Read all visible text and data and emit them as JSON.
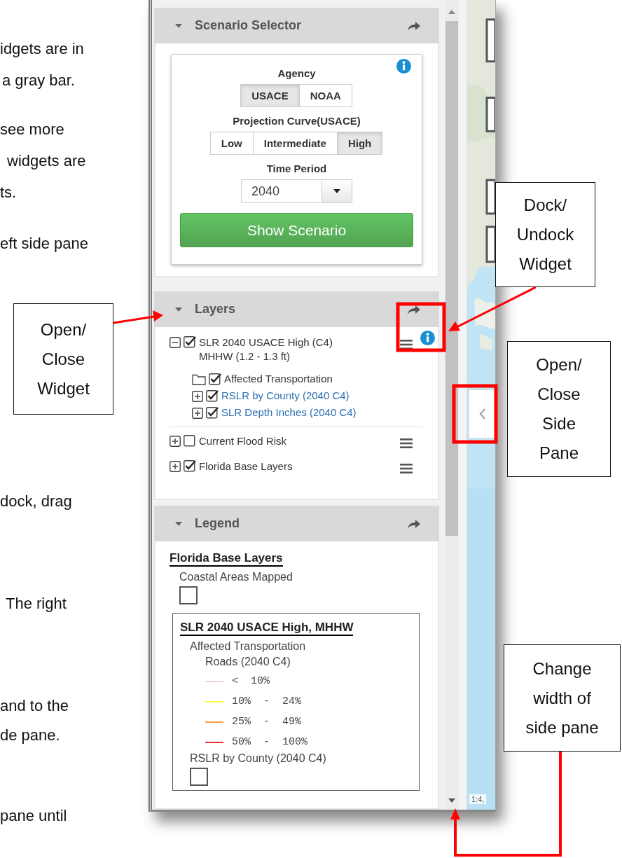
{
  "document_text": [
    "idgets are in",
    "a gray bar.",
    "see more",
    "widgets are",
    "ts.",
    "eft side pane",
    "dock, drag",
    "The right",
    "and to the",
    "de pane.",
    "pane until"
  ],
  "callouts": [
    {
      "text": "Dock/\nUndock\nWidget"
    },
    {
      "text": "Open/\nClose\nWidget"
    },
    {
      "text": "Open/\nClose\nSide\nPane"
    },
    {
      "text": "Change\nwidth of\nside pane"
    }
  ],
  "app": {
    "widgets": [
      {
        "kind": "scenario",
        "title": "Scenario Selector",
        "expanded": true,
        "agency": {
          "label": "Agency",
          "options": [
            {
              "label": "USACE",
              "selected": true
            },
            {
              "label": "NOAA",
              "selected": false
            }
          ]
        },
        "curve": {
          "label": "Projection Curve(USACE)",
          "options": [
            {
              "label": "Low",
              "selected": false
            },
            {
              "label": "Intermediate",
              "selected": false
            },
            {
              "label": "High",
              "selected": true
            }
          ]
        },
        "time_period": {
          "label": "Time Period",
          "value": "2040"
        },
        "button": "Show Scenario"
      },
      {
        "kind": "layers",
        "title": "Layers",
        "expanded": true,
        "items": [
          {
            "label": "SLR 2040 USACE High (C4) MHHW (1.2 - 1.3 ft)",
            "kind": "group",
            "expanded": true,
            "checked": true,
            "children": [
              {
                "label": "Affected Transportation",
                "kind": "folder",
                "checked": true
              },
              {
                "label": "RSLR by County (2040 C4)",
                "kind": "link",
                "expanded": false,
                "checked": true
              },
              {
                "label": "SLR Depth Inches (2040 C4)",
                "kind": "link",
                "expanded": false,
                "checked": true
              }
            ]
          },
          {
            "label": "Current Flood Risk",
            "kind": "group",
            "expanded": false,
            "checked": false
          },
          {
            "label": "Florida Base Layers",
            "kind": "group",
            "expanded": false,
            "checked": true
          }
        ]
      },
      {
        "kind": "legend",
        "title": "Legend",
        "expanded": true,
        "groups": [
          {
            "title": "Florida Base Layers",
            "framed": false,
            "entries": [
              {
                "kind": "label",
                "label": "Coastal Areas Mapped"
              },
              {
                "kind": "box"
              }
            ]
          },
          {
            "title": "SLR 2040 USACE High, MHHW",
            "framed": true,
            "entries": [
              {
                "kind": "label",
                "label": "Affected Transportation"
              },
              {
                "kind": "sublabel",
                "label": "Roads (2040 C4)"
              },
              {
                "kind": "line",
                "label": "<  10%",
                "color": "#f8d0d8"
              },
              {
                "kind": "line",
                "label": "10%  -  24%",
                "color": "#ffff40"
              },
              {
                "kind": "line",
                "label": "25%  -  49%",
                "color": "#ffa040"
              },
              {
                "kind": "line",
                "label": "50%  -  100%",
                "color": "#e83030"
              },
              {
                "kind": "label",
                "label": "RSLR by County (2040 C4)"
              },
              {
                "kind": "box"
              }
            ]
          }
        ]
      }
    ],
    "map": {
      "scale": "1:4,"
    }
  }
}
